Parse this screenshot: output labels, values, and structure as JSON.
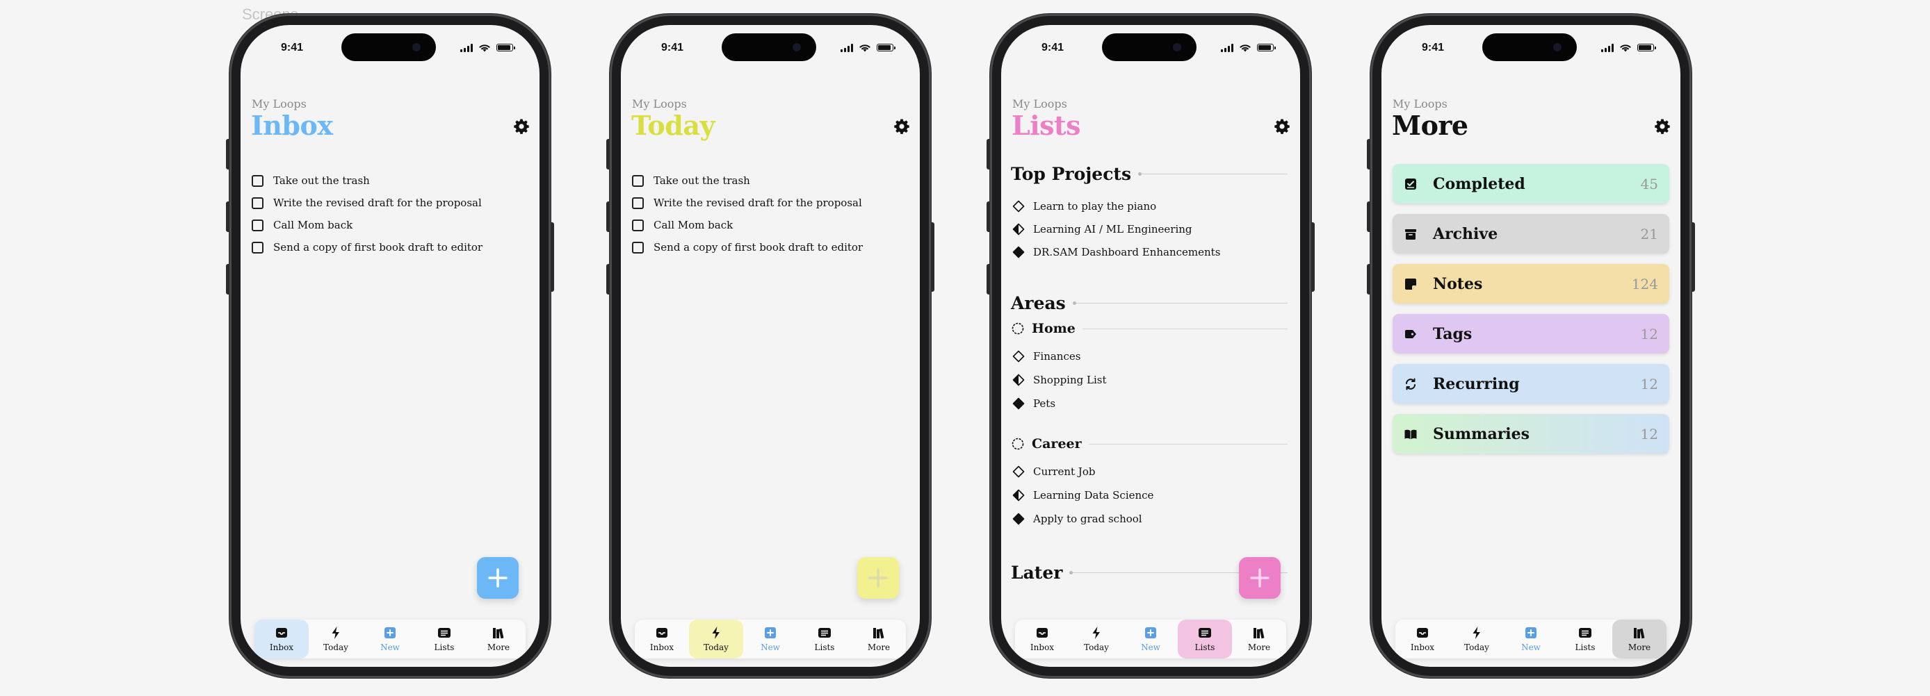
{
  "canvas": {
    "label": "Screens"
  },
  "status_time": "9:41",
  "eyebrow": "My Loops",
  "tab_labels": {
    "inbox": "Inbox",
    "today": "Today",
    "new": "New",
    "lists": "Lists",
    "more": "More"
  },
  "colors": {
    "inbox_accent": "#6cb8f6",
    "today_accent": "#d9df41",
    "lists_accent": "#ec7fc6",
    "inbox_tab_bg": "#d7e9f8",
    "today_tab_bg": "#f6f4b5",
    "lists_tab_bg": "#f3c4e2",
    "more_tab_bg": "#d6d6d6",
    "new_icon": "#5a9de8"
  },
  "inbox": {
    "title": "Inbox",
    "tasks": [
      "Take out the trash",
      "Write the revised draft for the proposal",
      "Call Mom back",
      "Send a copy of first book draft to editor"
    ]
  },
  "today": {
    "title": "Today",
    "tasks": [
      "Take out the trash",
      "Write the revised draft for the proposal",
      "Call Mom back",
      "Send a copy of first book draft to editor"
    ]
  },
  "lists": {
    "title": "Lists",
    "top_projects": {
      "title": "Top Projects",
      "items": [
        {
          "label": "Learn to play the piano",
          "icon": "diamond-empty-icon"
        },
        {
          "label": "Learning AI / ML Engineering",
          "icon": "diamond-half-icon"
        },
        {
          "label": "DR.SAM Dashboard Enhancements",
          "icon": "diamond-full-icon"
        }
      ]
    },
    "areas_title": "Areas",
    "home": {
      "title": "Home",
      "items": [
        {
          "label": "Finances",
          "icon": "diamond-empty-icon"
        },
        {
          "label": "Shopping List",
          "icon": "diamond-half-icon"
        },
        {
          "label": "Pets",
          "icon": "diamond-full-icon"
        }
      ]
    },
    "career": {
      "title": "Career",
      "items": [
        {
          "label": "Current Job",
          "icon": "diamond-empty-icon"
        },
        {
          "label": "Learning Data Science",
          "icon": "diamond-half-icon"
        },
        {
          "label": "Apply to grad school",
          "icon": "diamond-full-icon"
        }
      ]
    },
    "later_title": "Later"
  },
  "more": {
    "title": "More",
    "items": [
      {
        "label": "Completed",
        "count": "45",
        "icon": "check-square-icon"
      },
      {
        "label": "Archive",
        "count": "21",
        "icon": "archive-icon"
      },
      {
        "label": "Notes",
        "count": "124",
        "icon": "note-icon"
      },
      {
        "label": "Tags",
        "count": "12",
        "icon": "tag-icon"
      },
      {
        "label": "Recurring",
        "count": "12",
        "icon": "recurring-icon"
      },
      {
        "label": "Summaries",
        "count": "12",
        "icon": "book-icon"
      }
    ]
  }
}
